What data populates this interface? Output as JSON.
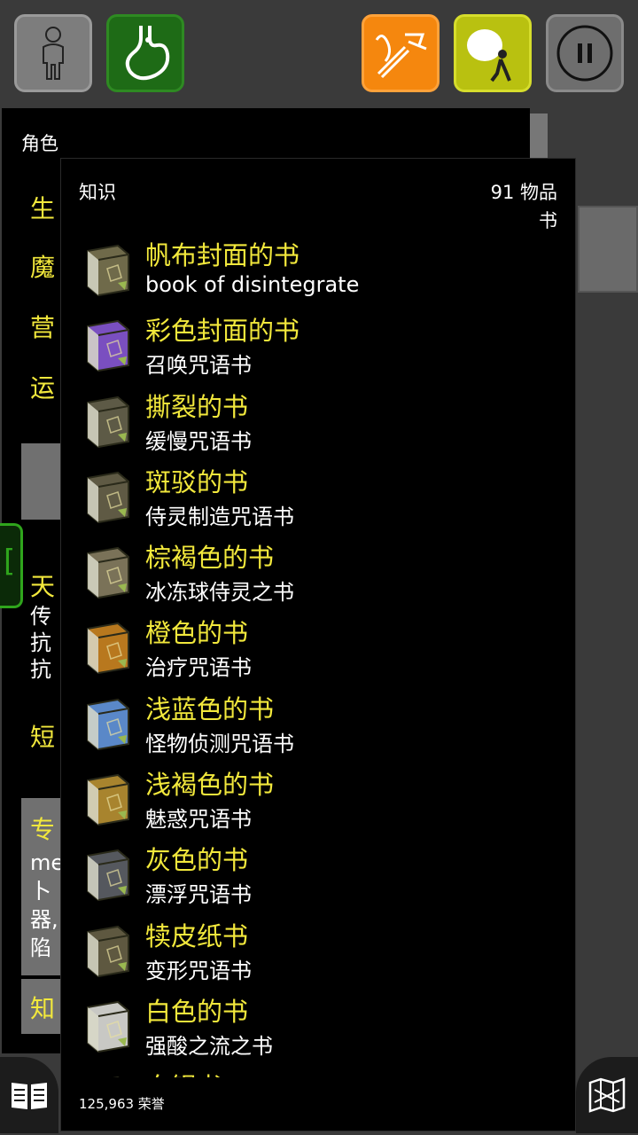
{
  "toolbar": {
    "character_icon": "person-icon",
    "hunger_icon": "stomach-icon",
    "fire_icon": "quiver-icon",
    "pack_icon": "backpack-icon",
    "pause_icon": "pause-icon"
  },
  "character_panel": {
    "title": "角色",
    "stat_labels": [
      "生",
      "魔",
      "营",
      "运"
    ],
    "section_label_1": "天",
    "lines_1": [
      "传",
      "抗",
      "抗"
    ],
    "section_label_2": "短",
    "section_label_3": "专",
    "lines_3": [
      "me",
      "卜",
      "器,",
      "陷"
    ],
    "section_label_4": "知"
  },
  "knowledge_panel": {
    "title": "知识",
    "count": "91 物品",
    "category": "书",
    "books": [
      {
        "name": "帆布封面的书",
        "desc": "book of disintegrate",
        "color": "#6f6a4a"
      },
      {
        "name": "彩色封面的书",
        "desc": "召唤咒语书",
        "color": "#7a4fc0"
      },
      {
        "name": "撕裂的书",
        "desc": "缓慢咒语书",
        "color": "#5d5a46"
      },
      {
        "name": "斑驳的书",
        "desc": "侍灵制造咒语书",
        "color": "#5f5a44"
      },
      {
        "name": "棕褐色的书",
        "desc": "冰冻球侍灵之书",
        "color": "#7a7258"
      },
      {
        "name": "橙色的书",
        "desc": "治疗咒语书",
        "color": "#b8781e"
      },
      {
        "name": "浅蓝色的书",
        "desc": "怪物侦测咒语书",
        "color": "#5a88c8"
      },
      {
        "name": "浅褐色的书",
        "desc": "魅惑咒语书",
        "color": "#a8842e"
      },
      {
        "name": "灰色的书",
        "desc": "漂浮咒语书",
        "color": "#55585e"
      },
      {
        "name": "犊皮纸书",
        "desc": "变形咒语书",
        "color": "#5e5840"
      },
      {
        "name": "白色的书",
        "desc": "强酸之流之书",
        "color": "#c8c8c4"
      },
      {
        "name": "白银书",
        "desc": "",
        "color": "#8a8a8a"
      }
    ],
    "honor": "125,963 荣誉"
  },
  "bottom": {
    "journal_icon": "book-icon",
    "map_icon": "map-icon"
  }
}
